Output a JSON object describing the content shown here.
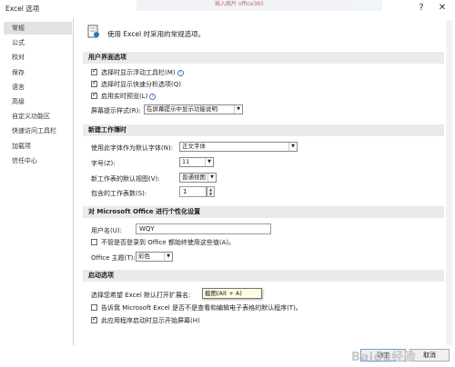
{
  "window": {
    "title": "Excel 选项",
    "help_icon": "?",
    "close_icon": "✕",
    "background_text": "插入图片 office365"
  },
  "sidebar": {
    "items": [
      {
        "label": "常规",
        "active": true
      },
      {
        "label": "公式"
      },
      {
        "label": "校对"
      },
      {
        "label": "保存"
      },
      {
        "label": "语言"
      },
      {
        "label": "高级"
      },
      {
        "label": "自定义功能区"
      },
      {
        "label": "快速访问工具栏"
      },
      {
        "label": "加载项"
      },
      {
        "label": "信任中心"
      }
    ]
  },
  "main": {
    "header_text": "使用 Excel 时采用的常规选项。",
    "ui_section": {
      "title": "用户界面选项",
      "check_mini_toolbar": "选择时显示浮动工具栏(M)",
      "check_quick_analysis": "选择时显示快速分析选项(Q)",
      "check_live_preview": "启用实时预览(L)",
      "tooltip_style_label": "屏幕提示样式(R):",
      "tooltip_style_value": "在屏幕提示中显示功能说明"
    },
    "new_wb_section": {
      "title": "新建工作簿时",
      "font_label": "使用此字体作为默认字体(N):",
      "font_value": "正文字体",
      "size_label": "字号(Z):",
      "size_value": "11",
      "view_label": "新工作表的默认视图(V):",
      "view_value": "普通视图",
      "sheets_label": "包含的工作表数(S):",
      "sheets_value": "1"
    },
    "personalize_section": {
      "title": "对 Microsoft Office 进行个性化设置",
      "username_label": "用户名(U):",
      "username_value": "WQY",
      "always_use_values": "不管是否登录到 Office 都始终使用这些值(A)。",
      "theme_label": "Office 主题(T):",
      "theme_value": "彩色"
    },
    "startup_section": {
      "title": "启动选项",
      "ext_label": "选择您希望 Excel 默认打开扩展名:",
      "tooltip": "截图(Alt + A)",
      "tell_me_default": "告诉我 Microsoft Excel 是否不是查看和编辑电子表格的默认程序(T)。",
      "show_start_screen": "此应用程序启动时显示开始屏幕(H)"
    }
  },
  "footer": {
    "ok_label": "确定",
    "cancel_label": "取消",
    "watermark": "Baidu经验"
  }
}
